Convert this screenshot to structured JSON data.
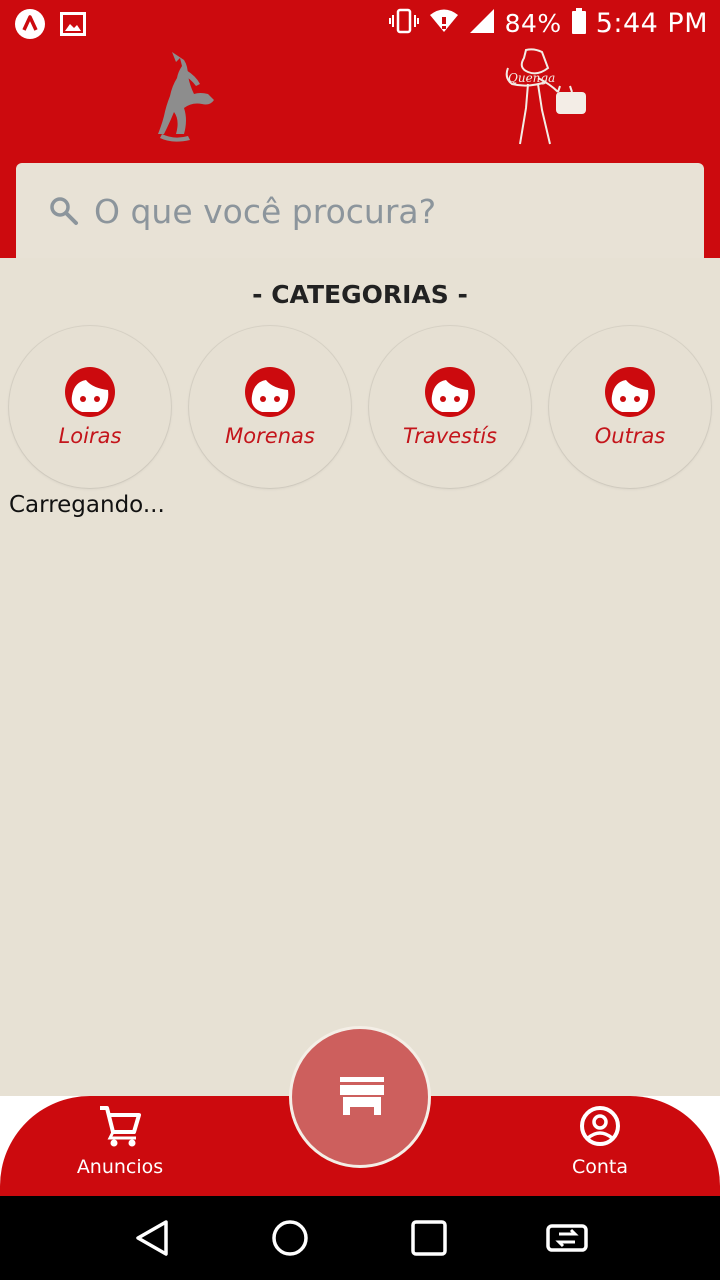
{
  "status_bar": {
    "battery": "84%",
    "time": "5:44 PM"
  },
  "header": {
    "logo_left_icon": "devil-figure-icon",
    "logo_right_icon": "woman-shopping-icon"
  },
  "search": {
    "placeholder": "O que você procura?"
  },
  "categories": {
    "title": "- CATEGORIAS -",
    "items": [
      {
        "label": "Loiras"
      },
      {
        "label": "Morenas"
      },
      {
        "label": "Travestís"
      },
      {
        "label": "Outras"
      }
    ]
  },
  "content": {
    "loading_text": "Carregando..."
  },
  "bottom_nav": {
    "left_label": "Anuncios",
    "right_label": "Conta",
    "center_icon": "store-icon"
  },
  "colors": {
    "brand_red": "#cc0a0e",
    "background": "#e7e1d4",
    "fab": "#cd5f5d"
  }
}
